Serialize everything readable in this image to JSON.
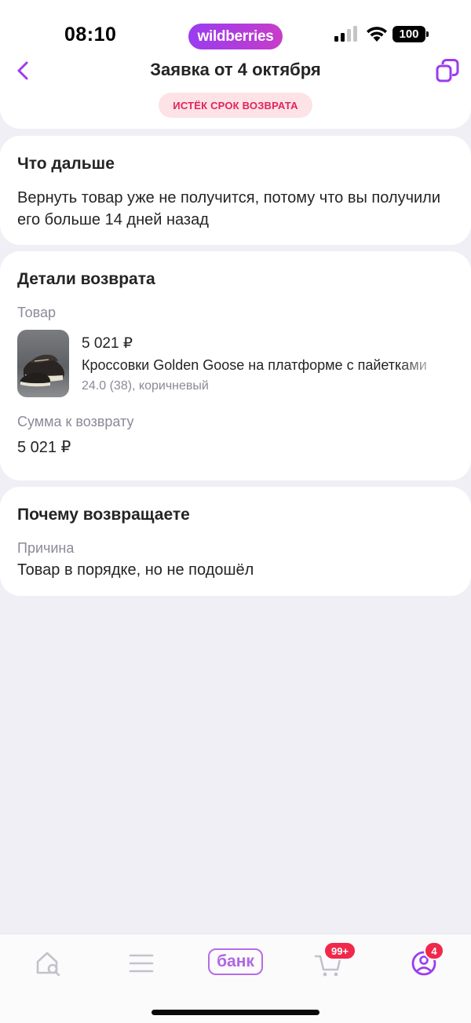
{
  "status_bar": {
    "time": "08:10",
    "brand": "wildberries",
    "battery": "100"
  },
  "header": {
    "title": "Заявка от 4 октября",
    "status_badge": "ИСТЁК СРОК ВОЗВРАТА",
    "back_icon": "chevron-left-icon",
    "copy_icon": "copy-icon"
  },
  "next_section": {
    "title": "Что дальше",
    "text": "Вернуть товар уже не получится, потому что вы получили его больше 14 дней назад"
  },
  "details_section": {
    "title": "Детали возврата",
    "product_label": "Товар",
    "product": {
      "price": "5 021 ₽",
      "name": "Кроссовки Golden Goose на платформе с пайетками",
      "variant": "24.0 (38), коричневый"
    },
    "refund_label": "Сумма к возврату",
    "refund_amount": "5 021 ₽"
  },
  "reason_section": {
    "title": "Почему возвращаете",
    "reason_label": "Причина",
    "reason_text": "Товар в порядке, но не подошёл"
  },
  "bottom_nav": {
    "items": [
      {
        "icon": "home-search-icon"
      },
      {
        "icon": "menu-icon"
      },
      {
        "label": "банк"
      },
      {
        "icon": "cart-icon",
        "badge": "99+"
      },
      {
        "icon": "profile-icon",
        "badge": "4"
      }
    ]
  },
  "colors": {
    "accent": "#9b3cf0",
    "badge_bg": "#fde3e6",
    "badge_text": "#e0245e",
    "nav_badge": "#f0284a",
    "background": "#f0eff5"
  }
}
